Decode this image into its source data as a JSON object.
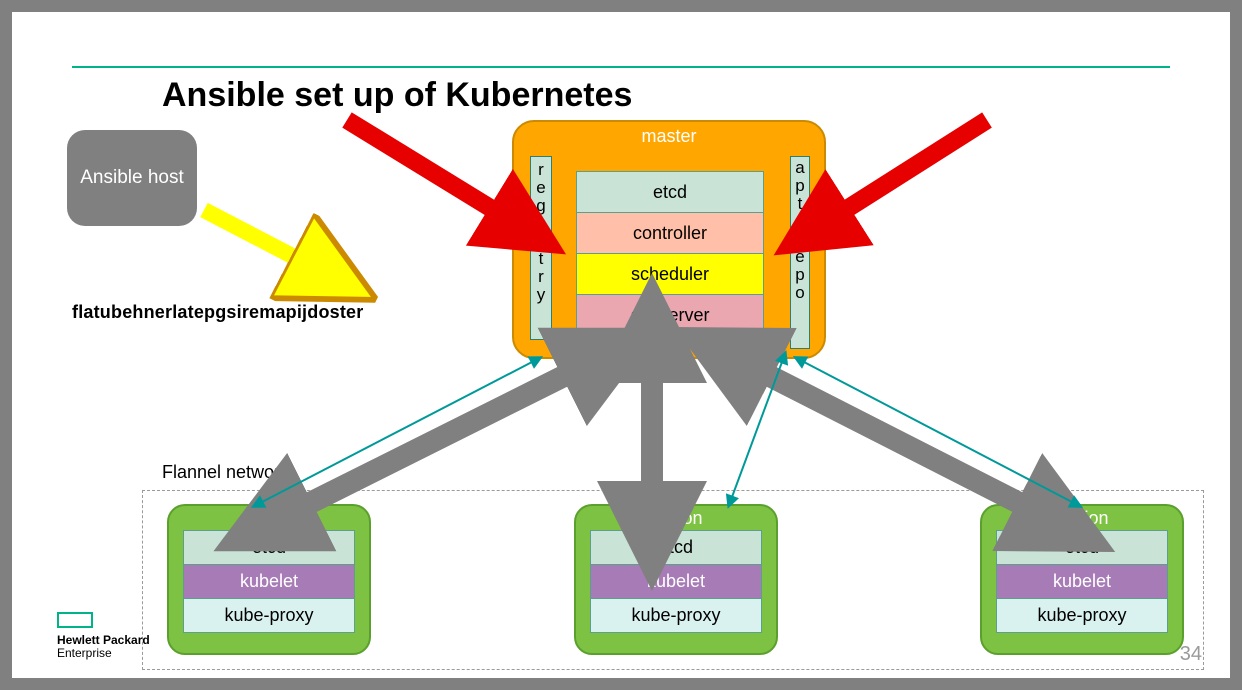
{
  "title": "Ansible set up of Kubernetes",
  "ansible_host": "Ansible host",
  "overlapped_text": "flatubehnerlatepgsiremapijdoster",
  "flannel_label": "Flannel network",
  "master": {
    "title": "master",
    "registry": "registry",
    "apt_repo": "apt repo",
    "cells": {
      "etcd": "etcd",
      "controller": "controller",
      "scheduler": "scheduler",
      "api": "api server"
    }
  },
  "minion": {
    "title": "minion",
    "cells": {
      "etcd": "etcd",
      "kubelet": "kubelet",
      "proxy": "kube-proxy"
    }
  },
  "logo": {
    "line1": "Hewlett Packard",
    "line2": "Enterprise"
  },
  "page_number": "34",
  "colors": {
    "accent": "#00b388",
    "master_bg": "#ffa600",
    "minion_bg": "#7dc242",
    "arrow_gray": "#808080",
    "arrow_red": "#e60000",
    "arrow_yellow": "#ffff00",
    "teal": "#009999"
  }
}
